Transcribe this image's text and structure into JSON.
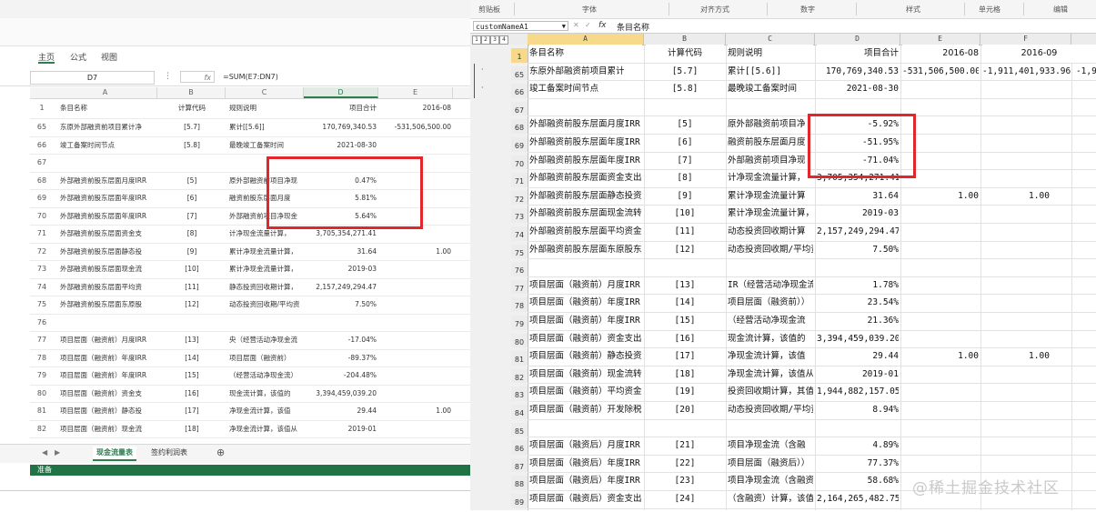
{
  "left": {
    "tabs": [
      "主页",
      "公式",
      "视图"
    ],
    "name_box": "D7",
    "formula_bar": {
      "fx": "fx",
      "formula": "=SUM(E7:DN7)"
    },
    "columns": [
      "A",
      "B",
      "C",
      "D",
      "E"
    ],
    "header_row": {
      "num": "1",
      "a": "条目名称",
      "b": "计算代码",
      "c": "规则说明",
      "d": "项目合计",
      "e": "2016-08"
    },
    "rows": [
      {
        "num": "65",
        "a": "东原外部融资前项目累计净",
        "b": "[5.7]",
        "c": "累计[[5.6]]",
        "d": "170,769,340.53",
        "e": "-531,506,500.00"
      },
      {
        "num": "66",
        "a": "竣工备案时间节点",
        "b": "[5.8]",
        "c": "最晚竣工备案时间",
        "d": "2021-08-30",
        "e": ""
      },
      {
        "num": "67",
        "a": "",
        "b": "",
        "c": "",
        "d": "",
        "e": ""
      },
      {
        "num": "68",
        "a": "外部融资前股东层面月度IRR",
        "b": "[5]",
        "c": "原外部融资前项目净现",
        "d": "0.47%",
        "e": ""
      },
      {
        "num": "69",
        "a": "外部融资前股东层面年度IRR",
        "b": "[6]",
        "c": "融资前股东层面月度",
        "d": "5.81%",
        "e": ""
      },
      {
        "num": "70",
        "a": "外部融资前股东层面年度IRR",
        "b": "[7]",
        "c": "外部融资前项目净现金",
        "d": "5.64%",
        "e": ""
      },
      {
        "num": "71",
        "a": "外部融资前股东层面资金支",
        "b": "[8]",
        "c": "计净现金流量计算，",
        "d": "3,705,354,271.41",
        "e": ""
      },
      {
        "num": "72",
        "a": "外部融资前股东层面静态投",
        "b": "[9]",
        "c": "累计净现金流量计算，",
        "d": "31.64",
        "e": "1.00"
      },
      {
        "num": "73",
        "a": "外部融资前股东层面现金流",
        "b": "[10]",
        "c": "累计净现金流量计算，",
        "d": "2019-03",
        "e": ""
      },
      {
        "num": "74",
        "a": "外部融资前股东层面平均资",
        "b": "[11]",
        "c": "静态投资回收期计算，",
        "d": "2,157,249,294.47",
        "e": ""
      },
      {
        "num": "75",
        "a": "外部融资前股东层面东原股",
        "b": "[12]",
        "c": "动态投资回收期/平均资",
        "d": "7.50%",
        "e": ""
      },
      {
        "num": "76",
        "a": "",
        "b": "",
        "c": "",
        "d": "",
        "e": ""
      },
      {
        "num": "77",
        "a": "项目层面（融资前）月度IRR",
        "b": "[13]",
        "c": "央（经营活动净现金流",
        "d": "-17.04%",
        "e": ""
      },
      {
        "num": "78",
        "a": "项目层面（融资前）年度IRR",
        "b": "[14]",
        "c": "项目层面（融资前）",
        "d": "-89.37%",
        "e": ""
      },
      {
        "num": "79",
        "a": "项目层面（融资前）年度IRR",
        "b": "[15]",
        "c": "（经营活动净现金流）",
        "d": "-204.48%",
        "e": ""
      },
      {
        "num": "80",
        "a": "项目层面（融资前）资金支",
        "b": "[16]",
        "c": "现金流计算，该值的",
        "d": "3,394,459,039.20",
        "e": ""
      },
      {
        "num": "81",
        "a": "项目层面（融资前）静态投",
        "b": "[17]",
        "c": "净现金流计算，该值",
        "d": "29.44",
        "e": "1.00"
      },
      {
        "num": "82",
        "a": "项目层面（融资前）现金流",
        "b": "[18]",
        "c": "净现金流计算，该值从",
        "d": "2019-01",
        "e": ""
      }
    ],
    "sheet_tabs": [
      "现金流量表",
      "签约利润表"
    ],
    "add_sheet": "⊕",
    "status": "准备"
  },
  "right": {
    "ribbon_groups": [
      "剪贴板",
      "字体",
      "对齐方式",
      "数字",
      "样式",
      "单元格",
      "编辑"
    ],
    "name_box": "customNameA1",
    "fx": "fx",
    "formula": "条目名称",
    "outline_levels": [
      "1",
      "2",
      "3",
      "4"
    ],
    "columns": [
      "A",
      "B",
      "C",
      "D",
      "E",
      "F"
    ],
    "header_row": {
      "num": "1",
      "a": "条目名称",
      "b": "计算代码",
      "c": "规则说明",
      "d": "项目合计",
      "e": "2016-08",
      "f": "2016-09"
    },
    "rows": [
      {
        "num": "65",
        "a": "东原外部融资前项目累计",
        "b": "[5.7]",
        "c": "累计[[5.6]]",
        "d": "170,769,340.53",
        "e": "-531,506,500.00",
        "f": "-1,911,401,933.96 -1,9"
      },
      {
        "num": "66",
        "a": "竣工备案时间节点",
        "b": "[5.8]",
        "c": "最晚竣工备案时间",
        "d": "2021-08-30",
        "e": "",
        "f": ""
      },
      {
        "num": "67",
        "a": "",
        "b": "",
        "c": "",
        "d": "",
        "e": "",
        "f": ""
      },
      {
        "num": "68",
        "a": "外部融资前股东层面月度IRR",
        "b": "[5]",
        "c": "原外部融资前项目净",
        "d": "-5.92%",
        "e": "",
        "f": ""
      },
      {
        "num": "69",
        "a": "外部融资前股东层面年度IRR",
        "b": "[6]",
        "c": "融资前股东层面月度",
        "d": "-51.95%",
        "e": "",
        "f": ""
      },
      {
        "num": "70",
        "a": "外部融资前股东层面年度IRR",
        "b": "[7]",
        "c": "外部融资前项目净现",
        "d": "-71.04%",
        "e": "",
        "f": ""
      },
      {
        "num": "71",
        "a": "外部融资前股东层面资金支出",
        "b": "[8]",
        "c": "计净现金流量计算，",
        "d": "3,705,354,271.41",
        "e": "",
        "f": ""
      },
      {
        "num": "72",
        "a": "外部融资前股东层面静态投资",
        "b": "[9]",
        "c": "累计净现金流量计算",
        "d": "31.64",
        "e": "1.00",
        "f": "1.00"
      },
      {
        "num": "73",
        "a": "外部融资前股东层面现金流转",
        "b": "[10]",
        "c": "累计净现金流量计算，",
        "d": "2019-03",
        "e": "",
        "f": ""
      },
      {
        "num": "74",
        "a": "外部融资前股东层面平均资金",
        "b": "[11]",
        "c": "动态投资回收期计算",
        "d": "2,157,249,294.47",
        "e": "",
        "f": ""
      },
      {
        "num": "75",
        "a": "外部融资前股东层面东原股东",
        "b": "[12]",
        "c": "动态投资回收期/平均资",
        "d": "7.50%",
        "e": "",
        "f": ""
      },
      {
        "num": "76",
        "a": "",
        "b": "",
        "c": "",
        "d": "",
        "e": "",
        "f": ""
      },
      {
        "num": "77",
        "a": "项目层面（融资前）月度IRR",
        "b": "[13]",
        "c": "IR（经营活动净现金流",
        "d": "1.78%",
        "e": "",
        "f": ""
      },
      {
        "num": "78",
        "a": "项目层面（融资前）年度IRR",
        "b": "[14]",
        "c": "项目层面（融资前））",
        "d": "23.54%",
        "e": "",
        "f": ""
      },
      {
        "num": "79",
        "a": "项目层面（融资前）年度IRR",
        "b": "[15]",
        "c": "（经营活动净现金流",
        "d": "21.36%",
        "e": "",
        "f": ""
      },
      {
        "num": "80",
        "a": "项目层面（融资前）资金支出",
        "b": "[16]",
        "c": "现金流计算，该值的",
        "d": "3,394,459,039.20",
        "e": "",
        "f": ""
      },
      {
        "num": "81",
        "a": "项目层面（融资前）静态投资",
        "b": "[17]",
        "c": "净现金流计算，该值",
        "d": "29.44",
        "e": "1.00",
        "f": "1.00"
      },
      {
        "num": "82",
        "a": "项目层面（融资前）现金流转",
        "b": "[18]",
        "c": "净现金流计算，该值从",
        "d": "2019-01",
        "e": "",
        "f": ""
      },
      {
        "num": "83",
        "a": "项目层面（融资前）平均资金",
        "b": "[19]",
        "c": "投资回收期计算，其值",
        "d": "1,944,882,157.05",
        "e": "",
        "f": ""
      },
      {
        "num": "84",
        "a": "项目层面（融资前）开发除税",
        "b": "[20]",
        "c": "动态投资回收期/平均资",
        "d": "8.94%",
        "e": "",
        "f": ""
      },
      {
        "num": "85",
        "a": "",
        "b": "",
        "c": "",
        "d": "",
        "e": "",
        "f": ""
      },
      {
        "num": "86",
        "a": "项目层面（融资后）月度IRR",
        "b": "[21]",
        "c": "项目净现金流（含融",
        "d": "4.89%",
        "e": "",
        "f": ""
      },
      {
        "num": "87",
        "a": "项目层面（融资后）年度IRR",
        "b": "[22]",
        "c": "项目层面（融资后））",
        "d": "77.37%",
        "e": "",
        "f": ""
      },
      {
        "num": "88",
        "a": "项目层面（融资后）年度IRR",
        "b": "[23]",
        "c": "项目净现金流（含融资",
        "d": "58.68%",
        "e": "",
        "f": ""
      },
      {
        "num": "89",
        "a": "项目层面（融资后）资金支出",
        "b": "[24]",
        "c": "（含融资）计算，该值",
        "d": "2,164,265,482.75",
        "e": "",
        "f": ""
      }
    ],
    "outline_dots": [
      "·",
      "·"
    ]
  },
  "watermark": "@稀土掘金技术社区"
}
